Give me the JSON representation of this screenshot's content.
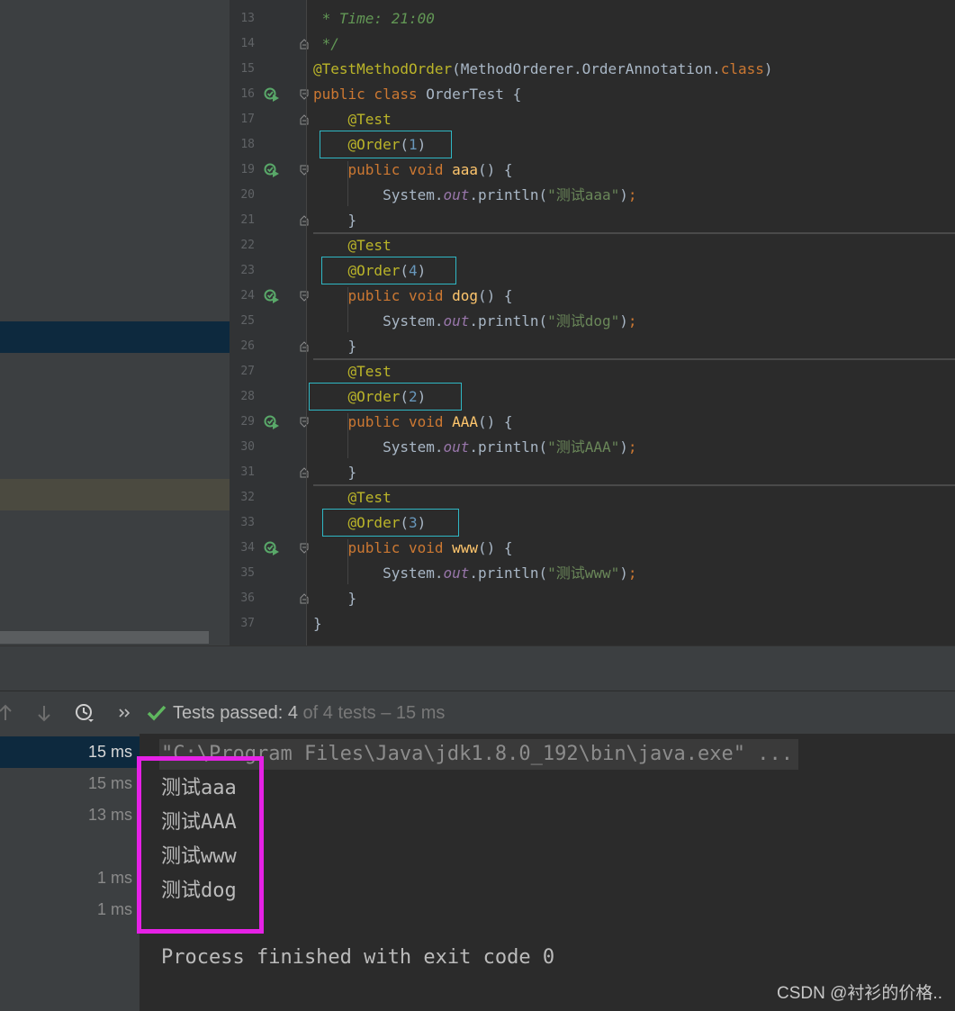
{
  "editor": {
    "lines": [
      {
        "n": "13",
        "html": "<span class=\"cmt\"> * Time: 21:00</span>"
      },
      {
        "n": "14",
        "html": "<span class=\"cmt\"> */</span>"
      },
      {
        "n": "15",
        "html": "<span class=\"ann\">@TestMethodOrder</span>(MethodOrderer.OrderAnnotation.<span class=\"kw\">class</span>)"
      },
      {
        "n": "16",
        "html": "<span class=\"kw\">public class </span>OrderTest {"
      },
      {
        "n": "17",
        "html": "    <span class=\"ann\">@Test</span>"
      },
      {
        "n": "18",
        "html": "    <span class=\"ann\">@Order</span>(<span class=\"num\">1</span>)"
      },
      {
        "n": "19",
        "html": "    <span class=\"kw\">public void </span><span class=\"fn\">aaa</span>() {"
      },
      {
        "n": "20",
        "html": "        System.<span class=\"fld\">out</span>.println(<span class=\"str\">\"测试aaa\"</span>)<span class=\"kw\">;</span>"
      },
      {
        "n": "21",
        "html": "    }"
      },
      {
        "n": "22",
        "html": "    <span class=\"ann\">@Test</span>"
      },
      {
        "n": "23",
        "html": "    <span class=\"ann\">@Order</span>(<span class=\"num\">4</span>)"
      },
      {
        "n": "24",
        "html": "    <span class=\"kw\">public void </span><span class=\"fn\">dog</span>() {"
      },
      {
        "n": "25",
        "html": "        System.<span class=\"fld\">out</span>.println(<span class=\"str\">\"测试dog\"</span>)<span class=\"kw\">;</span>"
      },
      {
        "n": "26",
        "html": "    }"
      },
      {
        "n": "27",
        "html": "    <span class=\"ann\">@Test</span>"
      },
      {
        "n": "28",
        "html": "    <span class=\"ann\">@Order</span>(<span class=\"num\">2</span>)"
      },
      {
        "n": "29",
        "html": "    <span class=\"kw\">public void </span><span class=\"fn\">AAA</span>() {"
      },
      {
        "n": "30",
        "html": "        System.<span class=\"fld\">out</span>.println(<span class=\"str\">\"测试AAA\"</span>)<span class=\"kw\">;</span>"
      },
      {
        "n": "31",
        "html": "    }"
      },
      {
        "n": "32",
        "html": "    <span class=\"ann\">@Test</span>"
      },
      {
        "n": "33",
        "html": "    <span class=\"ann\">@Order</span>(<span class=\"num\">3</span>)"
      },
      {
        "n": "34",
        "html": "    <span class=\"kw\">public void </span><span class=\"fn\">www</span>() {"
      },
      {
        "n": "35",
        "html": "        System.<span class=\"fld\">out</span>.println(<span class=\"str\">\"测试www\"</span>)<span class=\"kw\">;</span>"
      },
      {
        "n": "36",
        "html": "    }"
      },
      {
        "n": "37",
        "html": "}"
      }
    ]
  },
  "run": {
    "status_label": "Tests passed: ",
    "passed": "4",
    "status_rest": " of 4 tests – 15 ms",
    "durations": [
      "15 ms",
      "15 ms",
      "13 ms",
      "1 ms",
      "1 ms"
    ],
    "command": "\"C:\\Program Files\\Java\\jdk1.8.0_192\\bin\\java.exe\" ...",
    "output": [
      "测试aaa",
      "测试AAA",
      "测试www",
      "测试dog"
    ],
    "finish": "Process finished with exit code 0"
  },
  "watermark": "CSDN @衬衫的价格..",
  "colors": {
    "highlight_box": "#e621e6",
    "order_box": "#2fb7c4",
    "pass_check": "#5fb85f"
  }
}
